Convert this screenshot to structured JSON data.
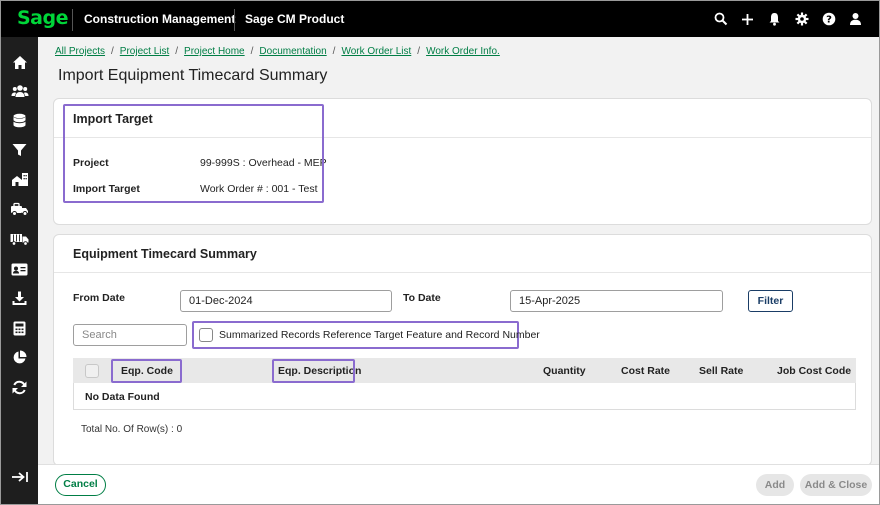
{
  "topbar": {
    "logo": "Sage",
    "app_name": "Construction Management",
    "product_name": "Sage CM Product"
  },
  "breadcrumb": [
    "All Projects",
    "Project List",
    "Project Home",
    "Documentation",
    "Work Order List",
    "Work Order Info."
  ],
  "page_title": "Import Equipment Timecard Summary",
  "import_target_card": {
    "title": "Import Target",
    "project_label": "Project",
    "project_value": "99-999S : Overhead - MEP",
    "target_label": "Import Target",
    "target_value": "Work Order # : 001 - Test"
  },
  "summary_card": {
    "title": "Equipment Timecard Summary",
    "from_date_label": "From Date",
    "from_date_value": "01-Dec-2024",
    "to_date_label": "To Date",
    "to_date_value": "15-Apr-2025",
    "filter_button": "Filter",
    "search_placeholder": "Search",
    "summarized_checkbox_label": "Summarized Records Reference Target Feature and Record Number",
    "columns": [
      "Eqp. Code",
      "Eqp. Description",
      "Quantity",
      "Cost Rate",
      "Sell Rate",
      "Job Cost Code"
    ],
    "empty_message": "No Data Found",
    "total_rows": "Total No. Of Row(s) : 0"
  },
  "footer": {
    "cancel": "Cancel",
    "add": "Add",
    "add_close": "Add & Close"
  },
  "colors": {
    "brand_green": "#00d639",
    "link_green": "#007e45",
    "highlight_purple": "#8a6bcf",
    "topbar_bg": "#000000",
    "sidebar_bg": "#1e1e1e"
  }
}
